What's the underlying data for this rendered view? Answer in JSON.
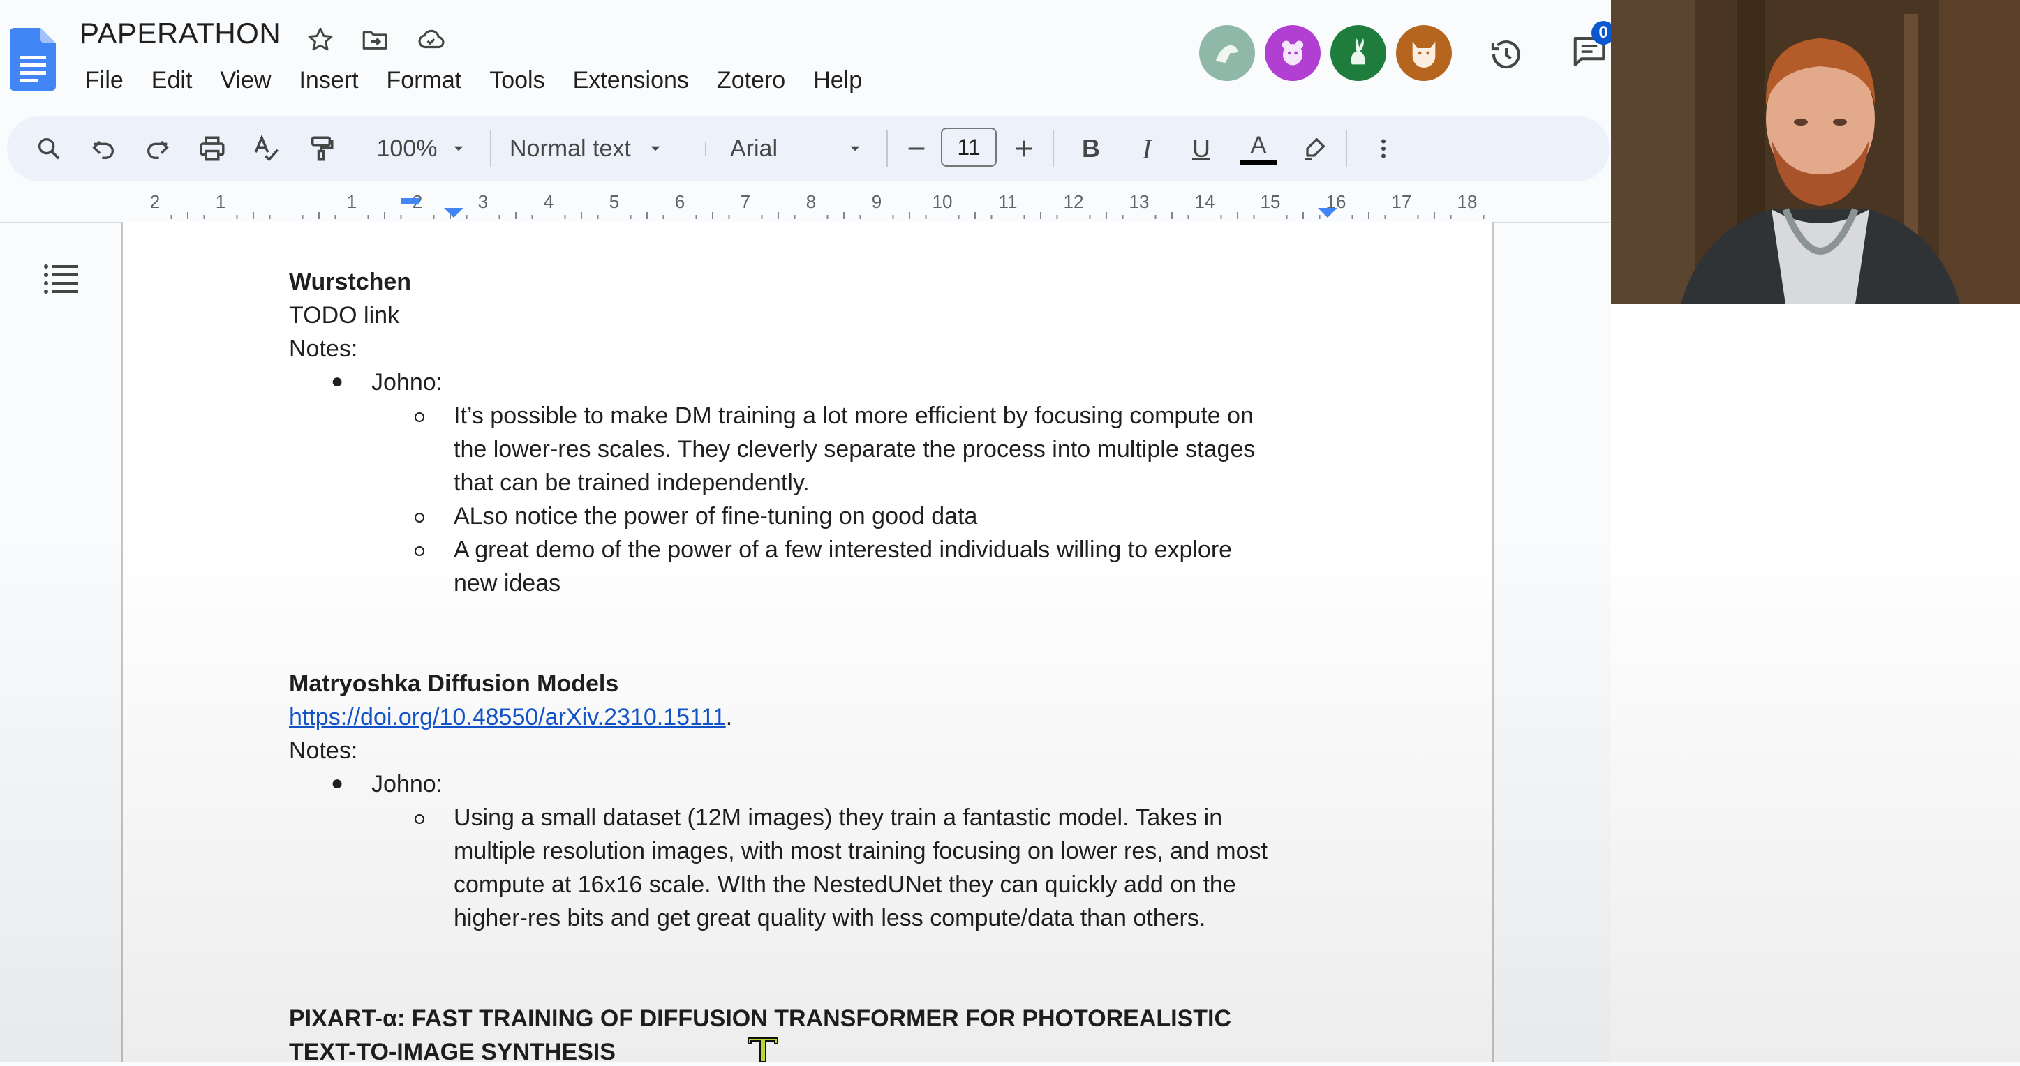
{
  "app": {
    "doc_title": "PAPERATHON",
    "menu": [
      "File",
      "Edit",
      "View",
      "Insert",
      "Format",
      "Tools",
      "Extensions",
      "Zotero",
      "Help"
    ],
    "comments_count": "0",
    "collaborators": [
      {
        "icon": "dog-avatar-icon",
        "color": "#8fb8a8"
      },
      {
        "icon": "bear-avatar-icon",
        "color": "#b13fd1"
      },
      {
        "icon": "rabbit-avatar-icon",
        "color": "#1e7d3c"
      },
      {
        "icon": "cat-avatar-icon",
        "color": "#b5651d"
      }
    ]
  },
  "toolbar": {
    "zoom": "100%",
    "style": "Normal text",
    "font": "Arial",
    "font_size": "11",
    "bold": "B",
    "italic": "I",
    "underline": "U",
    "text_color": "A"
  },
  "ruler": {
    "labels": [
      "2",
      "1",
      "",
      "1",
      "2",
      "3",
      "4",
      "5",
      "6",
      "7",
      "8",
      "9",
      "10",
      "11",
      "12",
      "13",
      "14",
      "15",
      "16",
      "17",
      "18"
    ]
  },
  "document": {
    "wurstchen": {
      "heading": "Wurstchen",
      "link": "TODO link",
      "notes_label": "Notes:",
      "author": "Johno:",
      "points": [
        [
          "It’s possible to make DM training a lot more efficient by focusing compute on",
          "the lower-res scales. They cleverly separate the process into multiple stages",
          "that can be trained independently."
        ],
        [
          "ALso notice the power of fine-tuning on good data"
        ],
        [
          "A great demo of the power of a few interested individuals willing to explore",
          "new ideas"
        ]
      ]
    },
    "matryoshka": {
      "heading": "Matryoshka Diffusion Models",
      "link": "https://doi.org/10.48550/arXiv.2310.15111",
      "link_suffix": ".",
      "notes_label": "Notes:",
      "author": "Johno:",
      "points": [
        [
          "Using a small dataset (12M images) they train a fantastic model. Takes in",
          "multiple resolution images, with most training focusing on lower res, and most",
          "compute at 16x16 scale. WIth the NestedUNet they can quickly add on the",
          "higher-res bits and get great quality with less compute/data than others."
        ]
      ]
    },
    "pixart": {
      "heading_line1": "PIXART-α: FAST TRAINING OF DIFFUSION TRANSFORMER FOR PHOTOREALISTIC",
      "heading_line2": "TEXT-TO-IMAGE SYNTHESIS"
    }
  },
  "colors": {
    "accent": "#0b57d0",
    "link": "#1155cc",
    "toolbar_bg": "#edf2fa"
  }
}
